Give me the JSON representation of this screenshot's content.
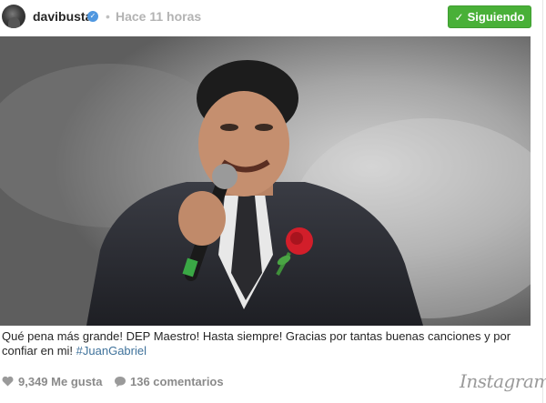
{
  "header": {
    "username": "davibusta",
    "separator": "•",
    "time": "Hace 11 horas",
    "follow_button": "Siguiendo"
  },
  "caption": {
    "text": "Qué pena más grande! DEP Maestro! Hasta siempre! Gracias por tantas buenas canciones y por confiar en mi!",
    "hashtag": "#JuanGabriel"
  },
  "footer": {
    "likes": "9,349 Me gusta",
    "comments": "136 comentarios",
    "brand": "Instagram"
  },
  "colors": {
    "follow_button_bg": "#49b038",
    "verified_badge": "#4f97e0",
    "hashtag": "#3f729b"
  },
  "icons": [
    "verified-badge-icon",
    "check-icon",
    "heart-icon",
    "comment-icon"
  ]
}
